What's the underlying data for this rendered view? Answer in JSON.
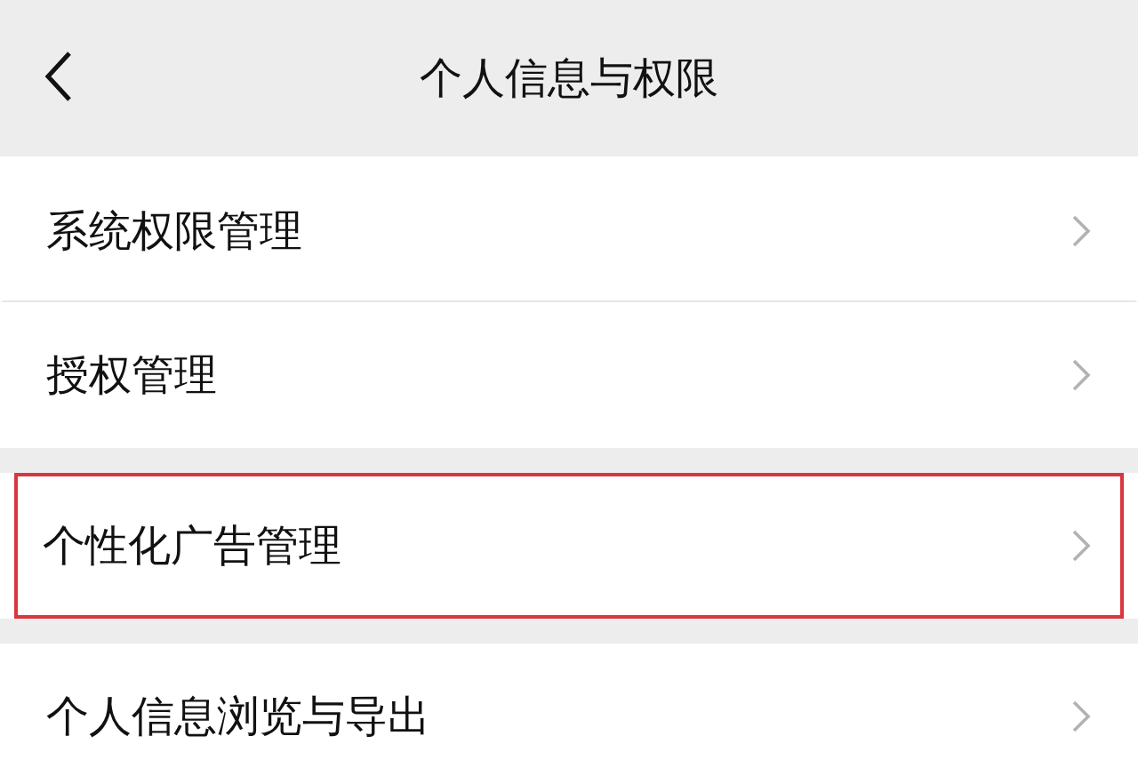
{
  "header": {
    "title": "个人信息与权限"
  },
  "sections": [
    {
      "items": [
        {
          "label": "系统权限管理",
          "highlighted": false
        },
        {
          "label": "授权管理",
          "highlighted": false
        }
      ]
    },
    {
      "items": [
        {
          "label": "个性化广告管理",
          "highlighted": true
        }
      ]
    },
    {
      "items": [
        {
          "label": "个人信息浏览与导出",
          "highlighted": false
        }
      ]
    }
  ]
}
